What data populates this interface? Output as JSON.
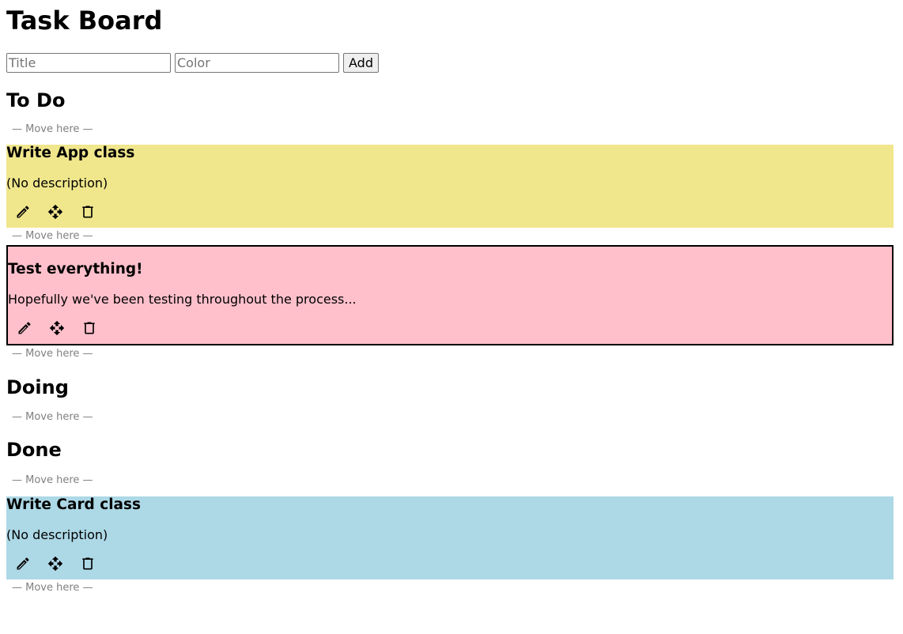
{
  "app": {
    "title": "Task Board"
  },
  "form": {
    "title_placeholder": "Title",
    "title_value": "",
    "color_placeholder": "Color",
    "color_value": "",
    "add_label": "Add"
  },
  "dropzone_label": "— Move here —",
  "columns": [
    {
      "title": "To Do",
      "cards": [
        {
          "title": "Write App class",
          "description": "(No description)",
          "color": "#f0e68c",
          "selected": false
        },
        {
          "title": "Test everything!",
          "description": "Hopefully we've been testing throughout the process...",
          "color": "#ffc0cb",
          "selected": true
        }
      ]
    },
    {
      "title": "Doing",
      "cards": []
    },
    {
      "title": "Done",
      "cards": [
        {
          "title": "Write Card class",
          "description": "(No description)",
          "color": "#add8e6",
          "selected": false
        }
      ]
    }
  ],
  "icons": {
    "edit": "pencil-icon",
    "move": "move-arrows-icon",
    "delete": "trash-icon"
  }
}
